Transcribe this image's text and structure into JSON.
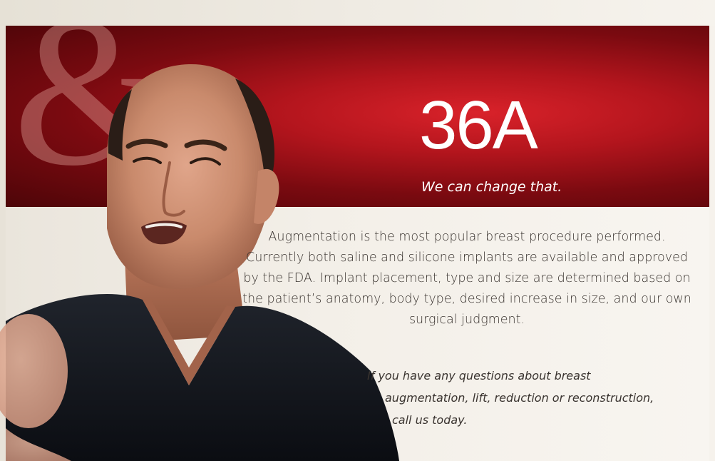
{
  "banner": {
    "ampersand": "&",
    "headline": "36A",
    "tagline": "We can change that."
  },
  "body": {
    "paragraph": "Augmentation is the most popular breast procedure performed. Currently both saline and silicone implants are available and approved by the FDA. Implant placement, type and size are determined based on the patient’s anatomy, body type, desired increase in size, and our own surgical judgment.",
    "cta_lines": [
      "If you have any questions about breast",
      "augmentation, lift, reduction or reconstruction,",
      "call us today."
    ]
  },
  "colors": {
    "banner_red": "#d9222a",
    "banner_dark": "#4d0508",
    "text": "#3a3430",
    "cream": "#f6f2ec"
  }
}
